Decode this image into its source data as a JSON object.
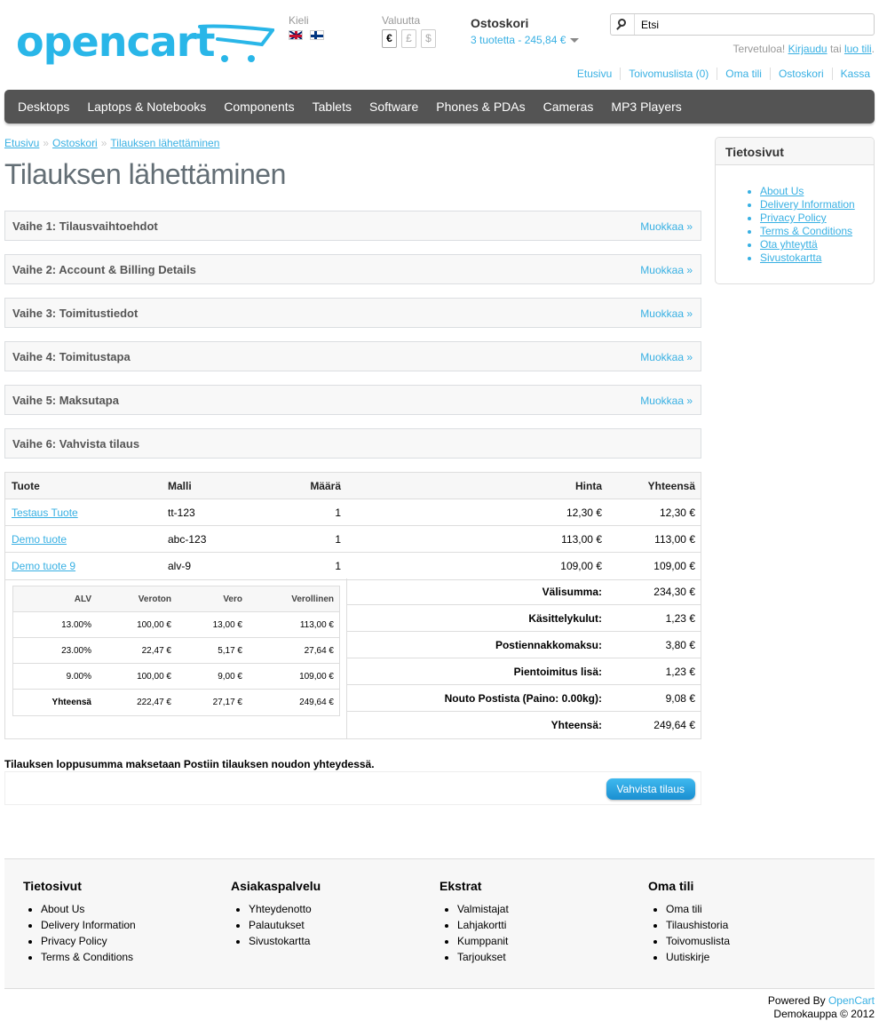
{
  "header": {
    "logo_text": "opencart",
    "language_label": "Kieli",
    "currency_label": "Valuutta",
    "currencies": [
      "€",
      "£",
      "$"
    ],
    "cart_title": "Ostoskori",
    "cart_total": "3 tuotetta - 245,84 €",
    "search_placeholder": "Etsi",
    "search_value": "Etsi",
    "welcome_prefix": "Tervetuloa!",
    "welcome_login": "Kirjaudu",
    "welcome_or": "tai",
    "welcome_register": "luo tili",
    "top_links": [
      "Etusivu",
      "Toivomuslista (0)",
      "Oma tili",
      "Ostoskori",
      "Kassa"
    ]
  },
  "menu": [
    "Desktops",
    "Laptops & Notebooks",
    "Components",
    "Tablets",
    "Software",
    "Phones & PDAs",
    "Cameras",
    "MP3 Players"
  ],
  "breadcrumb": [
    "Etusivu",
    "Ostoskori",
    "Tilauksen lähettäminen"
  ],
  "page_title": "Tilauksen lähettäminen",
  "steps": [
    {
      "title": "Vaihe 1: Tilausvaihtoehdot",
      "edit": "Muokkaa »"
    },
    {
      "title": "Vaihe 2: Account & Billing Details",
      "edit": "Muokkaa »"
    },
    {
      "title": "Vaihe 3: Toimitustiedot",
      "edit": "Muokkaa »"
    },
    {
      "title": "Vaihe 4: Toimitustapa",
      "edit": "Muokkaa »"
    },
    {
      "title": "Vaihe 5: Maksutapa",
      "edit": "Muokkaa »"
    },
    {
      "title": "Vaihe 6: Vahvista tilaus",
      "edit": ""
    }
  ],
  "order": {
    "headers": [
      "Tuote",
      "Malli",
      "Määrä",
      "Hinta",
      "Yhteensä"
    ],
    "rows": [
      {
        "product": "Testaus Tuote",
        "model": "tt-123",
        "qty": "1",
        "price": "12,30 €",
        "total": "12,30 €"
      },
      {
        "product": "Demo tuote",
        "model": "abc-123",
        "qty": "1",
        "price": "113,00 €",
        "total": "113,00 €"
      },
      {
        "product": "Demo tuote 9",
        "model": "alv-9",
        "qty": "1",
        "price": "109,00 €",
        "total": "109,00 €"
      }
    ]
  },
  "tax": {
    "headers": [
      "ALV",
      "Veroton",
      "Vero",
      "Verollinen"
    ],
    "rows": [
      [
        "13.00%",
        "100,00 €",
        "13,00 €",
        "113,00 €"
      ],
      [
        "23.00%",
        "22,47 €",
        "5,17 €",
        "27,64 €"
      ],
      [
        "9.00%",
        "100,00 €",
        "9,00 €",
        "109,00 €"
      ]
    ],
    "total": [
      "Yhteensä",
      "222,47 €",
      "27,17 €",
      "249,64 €"
    ]
  },
  "summary": [
    {
      "label": "Välisumma:",
      "value": "234,30 €"
    },
    {
      "label": "Käsittelykulut:",
      "value": "1,23 €"
    },
    {
      "label": "Postiennakkomaksu:",
      "value": "3,80 €"
    },
    {
      "label": "Pientoimitus lisä:",
      "value": "1,23 €"
    },
    {
      "label": "Nouto Postista (Paino: 0.00kg):",
      "value": "9,08 €"
    },
    {
      "label": "Yhteensä:",
      "value": "249,64 €"
    }
  ],
  "payment_note": "Tilauksen loppusumma maksetaan Postiin tilauksen noudon yhteydessä.",
  "confirm_label": "Vahvista tilaus",
  "sidebar": {
    "title": "Tietosivut",
    "items": [
      "About Us",
      "Delivery Information",
      "Privacy Policy",
      "Terms & Conditions",
      "Ota yhteyttä",
      "Sivustokartta"
    ]
  },
  "footer": {
    "columns": [
      {
        "title": "Tietosivut",
        "items": [
          "About Us",
          "Delivery Information",
          "Privacy Policy",
          "Terms & Conditions"
        ]
      },
      {
        "title": "Asiakaspalvelu",
        "items": [
          "Yhteydenotto",
          "Palautukset",
          "Sivustokartta"
        ]
      },
      {
        "title": "Ekstrat",
        "items": [
          "Valmistajat",
          "Lahjakortti",
          "Kumppanit",
          "Tarjoukset"
        ]
      },
      {
        "title": "Oma tili",
        "items": [
          "Oma tili",
          "Tilaushistoria",
          "Toivomuslista",
          "Uutiskirje"
        ]
      }
    ],
    "powered_prefix": "Powered By",
    "powered_link": "OpenCart",
    "copyright": "Demokauppa © 2012"
  },
  "colors": {
    "accent": "#38b0e3",
    "menu_bg": "#545454",
    "button": "#1a8fd1"
  }
}
